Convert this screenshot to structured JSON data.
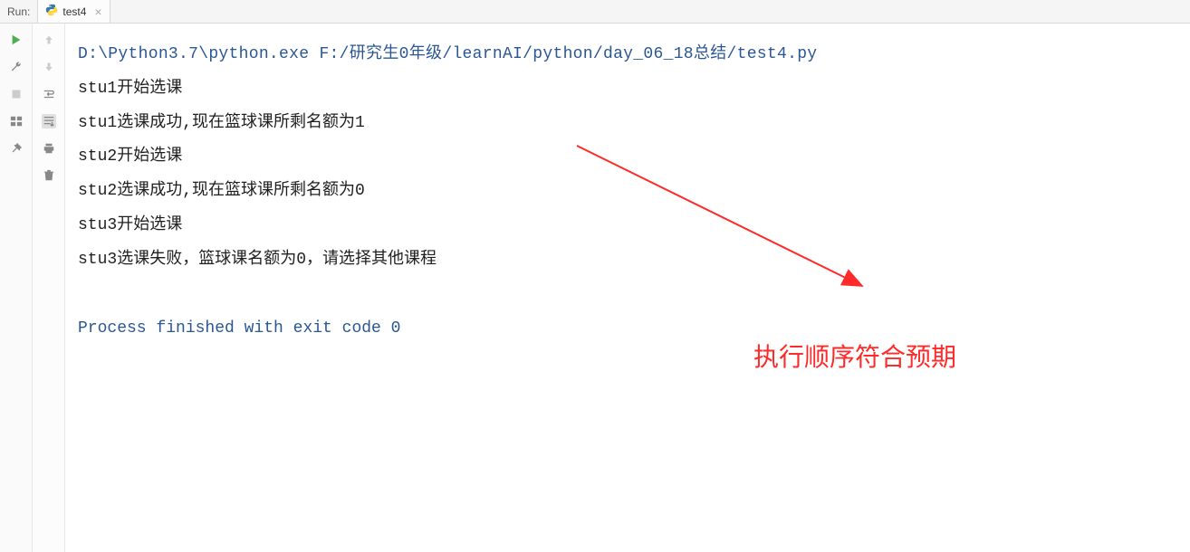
{
  "toolbar": {
    "run_label": "Run:",
    "tab_name": "test4",
    "close_symbol": "×"
  },
  "console": {
    "command": "D:\\Python3.7\\python.exe F:/研究生0年级/learnAI/python/day_06_18总结/test4.py",
    "lines": [
      "stu1开始选课",
      "stu1选课成功,现在篮球课所剩名额为1",
      "stu2开始选课",
      "stu2选课成功,现在篮球课所剩名额为0",
      "stu3开始选课",
      "stu3选课失败，篮球课名额为0，请选择其他课程"
    ],
    "exit_message": "Process finished with exit code 0"
  },
  "annotation": {
    "text": "执行顺序符合预期"
  },
  "icons": {
    "play": "play-icon",
    "wrench": "wrench-icon",
    "stop": "stop-icon",
    "layout": "layout-icon",
    "pin": "pin-icon",
    "up": "up-arrow-icon",
    "down": "down-arrow-icon",
    "wrap": "wrap-icon",
    "scroll": "scroll-icon",
    "print": "print-icon",
    "trash": "trash-icon"
  }
}
